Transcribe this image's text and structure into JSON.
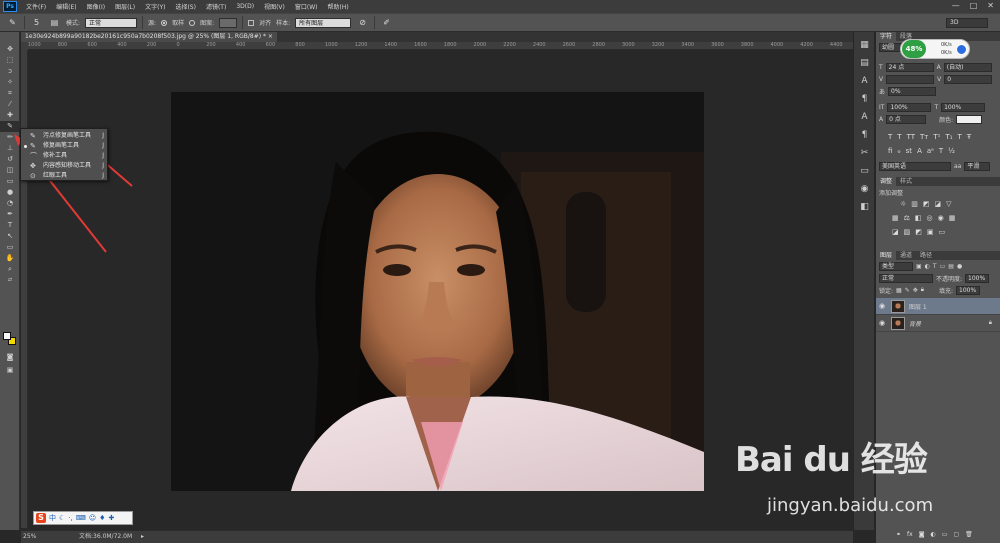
{
  "app": {
    "logo": "Ps"
  },
  "menubar": {
    "items": [
      "文件(F)",
      "编辑(E)",
      "图像(I)",
      "图层(L)",
      "文字(Y)",
      "选择(S)",
      "滤镜(T)",
      "3D(D)",
      "视图(V)",
      "窗口(W)",
      "帮助(H)"
    ]
  },
  "window_controls": {
    "minimize": "—",
    "restore": "□",
    "close": "✕"
  },
  "options": {
    "brush_size": "5",
    "mode_label": "模式:",
    "mode_value": "正常",
    "source_label": "源:",
    "source_sample": "取样",
    "source_pattern": "图案:",
    "aligned_label": "对齐",
    "sample_label": "样本:",
    "sample_value": "所有图层",
    "workspace": "3D"
  },
  "document": {
    "tab_title": "1e30e924b899a90182be20161c950a7b0208f503.jpg @ 25% (图层 1, RGB/8#) *  ×"
  },
  "ruler_ticks": [
    "1000",
    "800",
    "600",
    "400",
    "200",
    "0",
    "200",
    "400",
    "600",
    "800",
    "1000",
    "1200",
    "1400",
    "1600",
    "1800",
    "2000",
    "2200",
    "2400",
    "2600",
    "2800",
    "3000",
    "3200",
    "3400",
    "3600",
    "3800",
    "4000",
    "4200",
    "4400"
  ],
  "flyout": {
    "items": [
      {
        "label": "污点修复画笔工具",
        "key": "J",
        "selected": false
      },
      {
        "label": "修复画笔工具",
        "key": "J",
        "selected": true
      },
      {
        "label": "修补工具",
        "key": "J",
        "selected": false
      },
      {
        "label": "内容感知移动工具",
        "key": "J",
        "selected": false
      },
      {
        "label": "红眼工具",
        "key": "J",
        "selected": false
      }
    ]
  },
  "status": {
    "zoom": "25%",
    "doc_info": "文档:36.0M/72.0M"
  },
  "ime": {
    "logo": "S",
    "mode": "中"
  },
  "netmon": {
    "percent": "48%",
    "up": "0K/s",
    "down": "0K/s"
  },
  "character_panel": {
    "tabs": [
      "字符",
      "段落"
    ],
    "font_family": "幼圆",
    "font_size": "24 点",
    "leading": "(自动)",
    "kerning": "0",
    "tracking": "0%",
    "vscale": "100%",
    "hscale": "100%",
    "baseline": "0 点",
    "color_label": "颜色:",
    "language": "美国英语",
    "antialias": "平滑"
  },
  "adjustments_panel": {
    "tabs": [
      "调整",
      "样式"
    ],
    "heading": "添加调整"
  },
  "layers_panel": {
    "tabs": [
      "图层",
      "通道",
      "路径"
    ],
    "filter": "类型",
    "blend_mode": "正常",
    "opacity_label": "不透明度:",
    "opacity": "100%",
    "lock_label": "锁定:",
    "fill_label": "填充:",
    "fill": "100%",
    "layers": [
      {
        "name": "图层 1",
        "selected": true,
        "locked": false
      },
      {
        "name": "背景",
        "selected": false,
        "locked": true
      }
    ]
  },
  "watermark": {
    "brand": "Bai du 经验",
    "url": "jingyan.baidu.com"
  },
  "colors": {
    "ui_bg": "#535353",
    "annotation_arrow": "#e03a36",
    "selected_layer": "#6d7a8c"
  }
}
